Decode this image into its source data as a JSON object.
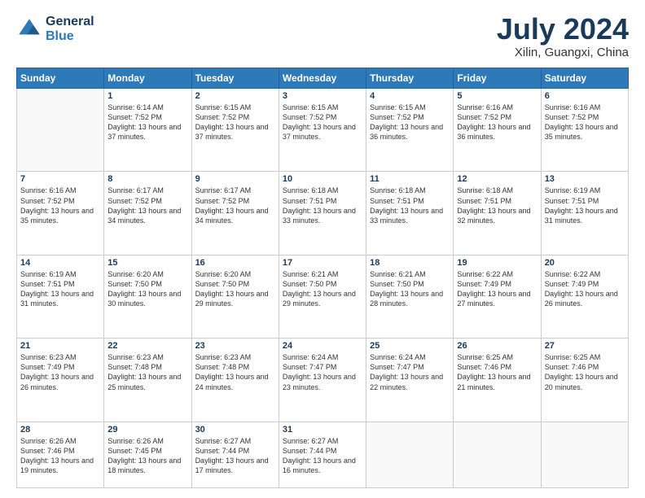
{
  "header": {
    "logo": {
      "general": "General",
      "blue": "Blue"
    },
    "month_year": "July 2024",
    "location": "Xilin, Guangxi, China"
  },
  "weekdays": [
    "Sunday",
    "Monday",
    "Tuesday",
    "Wednesday",
    "Thursday",
    "Friday",
    "Saturday"
  ],
  "weeks": [
    [
      {
        "day": "",
        "empty": true
      },
      {
        "day": "1",
        "sunrise": "6:14 AM",
        "sunset": "7:52 PM",
        "daylight": "13 hours and 37 minutes."
      },
      {
        "day": "2",
        "sunrise": "6:15 AM",
        "sunset": "7:52 PM",
        "daylight": "13 hours and 37 minutes."
      },
      {
        "day": "3",
        "sunrise": "6:15 AM",
        "sunset": "7:52 PM",
        "daylight": "13 hours and 37 minutes."
      },
      {
        "day": "4",
        "sunrise": "6:15 AM",
        "sunset": "7:52 PM",
        "daylight": "13 hours and 36 minutes."
      },
      {
        "day": "5",
        "sunrise": "6:16 AM",
        "sunset": "7:52 PM",
        "daylight": "13 hours and 36 minutes."
      },
      {
        "day": "6",
        "sunrise": "6:16 AM",
        "sunset": "7:52 PM",
        "daylight": "13 hours and 35 minutes."
      }
    ],
    [
      {
        "day": "7",
        "sunrise": "6:16 AM",
        "sunset": "7:52 PM",
        "daylight": "13 hours and 35 minutes."
      },
      {
        "day": "8",
        "sunrise": "6:17 AM",
        "sunset": "7:52 PM",
        "daylight": "13 hours and 34 minutes."
      },
      {
        "day": "9",
        "sunrise": "6:17 AM",
        "sunset": "7:52 PM",
        "daylight": "13 hours and 34 minutes."
      },
      {
        "day": "10",
        "sunrise": "6:18 AM",
        "sunset": "7:51 PM",
        "daylight": "13 hours and 33 minutes."
      },
      {
        "day": "11",
        "sunrise": "6:18 AM",
        "sunset": "7:51 PM",
        "daylight": "13 hours and 33 minutes."
      },
      {
        "day": "12",
        "sunrise": "6:18 AM",
        "sunset": "7:51 PM",
        "daylight": "13 hours and 32 minutes."
      },
      {
        "day": "13",
        "sunrise": "6:19 AM",
        "sunset": "7:51 PM",
        "daylight": "13 hours and 31 minutes."
      }
    ],
    [
      {
        "day": "14",
        "sunrise": "6:19 AM",
        "sunset": "7:51 PM",
        "daylight": "13 hours and 31 minutes."
      },
      {
        "day": "15",
        "sunrise": "6:20 AM",
        "sunset": "7:50 PM",
        "daylight": "13 hours and 30 minutes."
      },
      {
        "day": "16",
        "sunrise": "6:20 AM",
        "sunset": "7:50 PM",
        "daylight": "13 hours and 29 minutes."
      },
      {
        "day": "17",
        "sunrise": "6:21 AM",
        "sunset": "7:50 PM",
        "daylight": "13 hours and 29 minutes."
      },
      {
        "day": "18",
        "sunrise": "6:21 AM",
        "sunset": "7:50 PM",
        "daylight": "13 hours and 28 minutes."
      },
      {
        "day": "19",
        "sunrise": "6:22 AM",
        "sunset": "7:49 PM",
        "daylight": "13 hours and 27 minutes."
      },
      {
        "day": "20",
        "sunrise": "6:22 AM",
        "sunset": "7:49 PM",
        "daylight": "13 hours and 26 minutes."
      }
    ],
    [
      {
        "day": "21",
        "sunrise": "6:23 AM",
        "sunset": "7:49 PM",
        "daylight": "13 hours and 26 minutes."
      },
      {
        "day": "22",
        "sunrise": "6:23 AM",
        "sunset": "7:48 PM",
        "daylight": "13 hours and 25 minutes."
      },
      {
        "day": "23",
        "sunrise": "6:23 AM",
        "sunset": "7:48 PM",
        "daylight": "13 hours and 24 minutes."
      },
      {
        "day": "24",
        "sunrise": "6:24 AM",
        "sunset": "7:47 PM",
        "daylight": "13 hours and 23 minutes."
      },
      {
        "day": "25",
        "sunrise": "6:24 AM",
        "sunset": "7:47 PM",
        "daylight": "13 hours and 22 minutes."
      },
      {
        "day": "26",
        "sunrise": "6:25 AM",
        "sunset": "7:46 PM",
        "daylight": "13 hours and 21 minutes."
      },
      {
        "day": "27",
        "sunrise": "6:25 AM",
        "sunset": "7:46 PM",
        "daylight": "13 hours and 20 minutes."
      }
    ],
    [
      {
        "day": "28",
        "sunrise": "6:26 AM",
        "sunset": "7:46 PM",
        "daylight": "13 hours and 19 minutes."
      },
      {
        "day": "29",
        "sunrise": "6:26 AM",
        "sunset": "7:45 PM",
        "daylight": "13 hours and 18 minutes."
      },
      {
        "day": "30",
        "sunrise": "6:27 AM",
        "sunset": "7:44 PM",
        "daylight": "13 hours and 17 minutes."
      },
      {
        "day": "31",
        "sunrise": "6:27 AM",
        "sunset": "7:44 PM",
        "daylight": "13 hours and 16 minutes."
      },
      {
        "day": "",
        "empty": true
      },
      {
        "day": "",
        "empty": true
      },
      {
        "day": "",
        "empty": true
      }
    ]
  ]
}
